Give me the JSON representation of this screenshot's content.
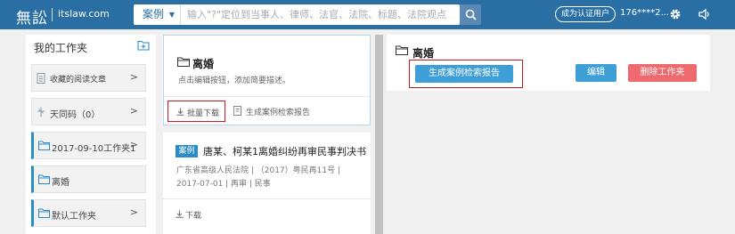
{
  "header": {
    "logo": "無訟",
    "domain": "itslaw.com",
    "search_type": "案例",
    "search_placeholder": "输入\"?\"定位到当事人、律师、法官、法院、标题、法院观点",
    "cert_button": "成为认证用户",
    "user": "176****2..."
  },
  "sidebar": {
    "title": "我的工作夹",
    "items": [
      {
        "label": "收藏的阅读文章",
        "icon": "document-icon"
      },
      {
        "label": "天同码（0）",
        "icon": "cross-icon"
      },
      {
        "label": "2017-09-10工作夹1",
        "icon": "folder-icon"
      },
      {
        "label": "离婚",
        "icon": "folder-icon"
      },
      {
        "label": "默认工作夹",
        "icon": "folder-icon"
      }
    ]
  },
  "folder_card": {
    "name": "离婚",
    "description": "点击编辑按钮，添加简要描述。",
    "batch_download": "批量下载",
    "generate_report": "生成案例检索报告"
  },
  "case_card": {
    "badge": "案例",
    "title": "唐某、柯某1离婚纠纷再审民事判决书",
    "meta1": "广东省高级人民法院  |  （2017）粤民再11号  |",
    "meta2": "2017-07-01  |  再审  |  民事",
    "download": "下载"
  },
  "right_panel": {
    "title": "离婚",
    "report_button": "生成案例检索报告",
    "edit_button": "编辑",
    "delete_button": "删除工作夹"
  },
  "colors": {
    "header_bg": "#2a6fa3",
    "primary_button": "#3e9fd6",
    "danger_button": "#ee6a6f",
    "highlight_frame": "#d0151d"
  }
}
